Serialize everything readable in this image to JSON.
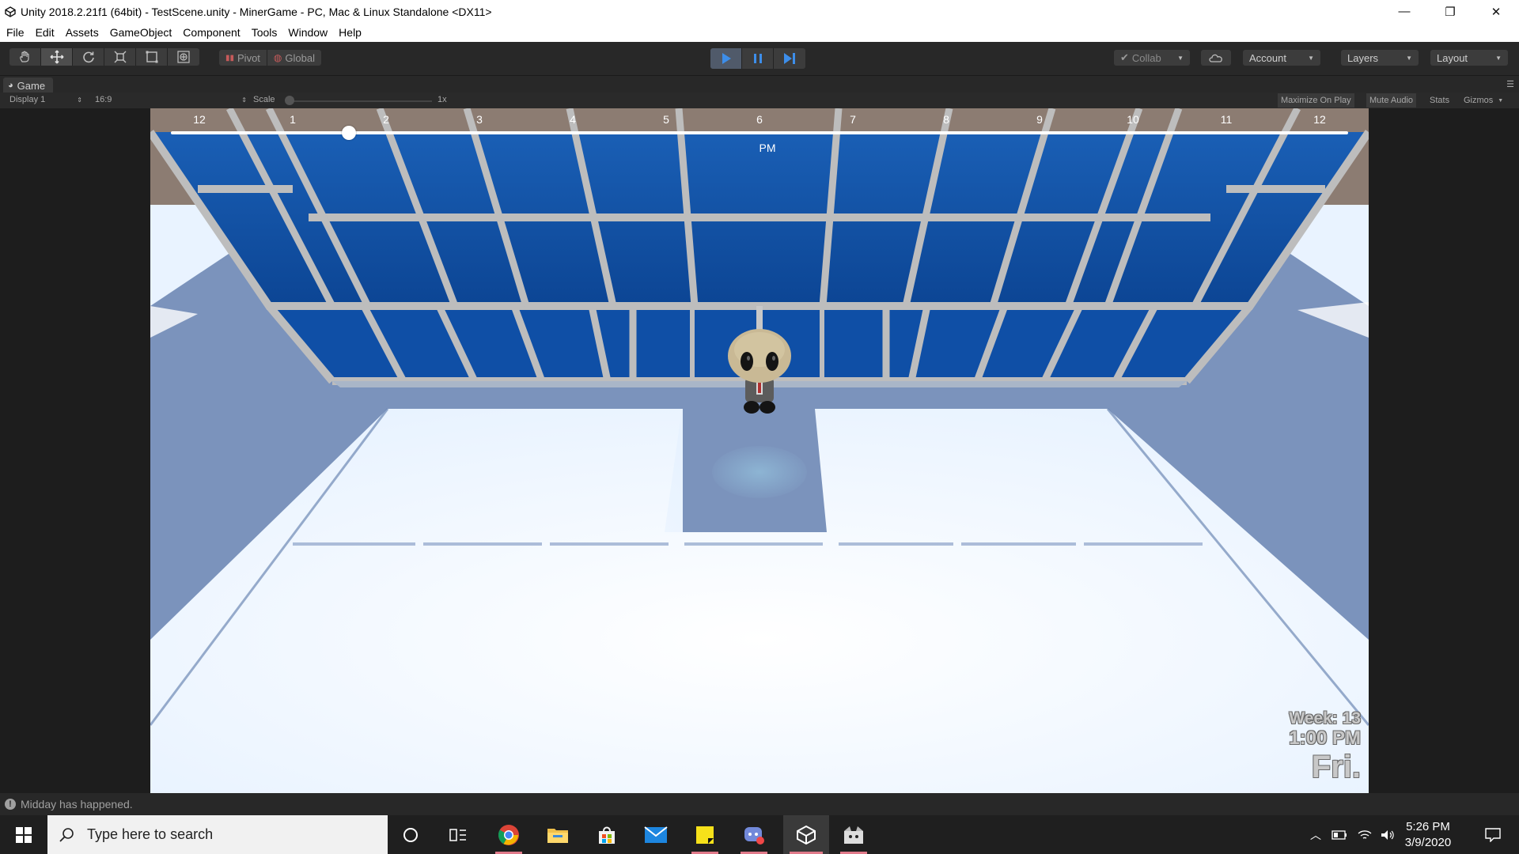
{
  "window": {
    "title": "Unity 2018.2.21f1 (64bit) - TestScene.unity - MinerGame - PC, Mac & Linux Standalone <DX11>",
    "controls": [
      "—",
      "❐",
      "✕"
    ]
  },
  "menu": [
    "File",
    "Edit",
    "Assets",
    "GameObject",
    "Component",
    "Tools",
    "Window",
    "Help"
  ],
  "toolbar": {
    "tools": [
      "hand-tool-icon",
      "move-tool-icon",
      "rotate-tool-icon",
      "scale-tool-icon",
      "rect-tool-icon",
      "transform-tool-icon"
    ],
    "pivot": "Pivot",
    "global": "Global",
    "collab": "Collab",
    "account": "Account",
    "layers": "Layers",
    "layout": "Layout",
    "play_state": "playing"
  },
  "game_tab": {
    "label": "Game"
  },
  "game_toolbar": {
    "display": "Display 1",
    "aspect": "16:9",
    "scale_label": "Scale",
    "scale_value": "1x",
    "maximize_on_play": "Maximize On Play",
    "mute_audio": "Mute Audio",
    "stats": "Stats",
    "gizmos": "Gizmos"
  },
  "game": {
    "timeline_hours": [
      "12",
      "1",
      "2",
      "3",
      "4",
      "5",
      "6",
      "7",
      "8",
      "9",
      "10",
      "11",
      "12"
    ],
    "timeline_position_hours": 1.6,
    "period": "PM",
    "hud": {
      "week": "Week: 13",
      "time": "1:00 PM",
      "day": "Fri."
    }
  },
  "status": {
    "message": "Midday has happened."
  },
  "taskbar": {
    "search_placeholder": "Type here to search",
    "time": "5:26 PM",
    "date": "3/9/2020",
    "apps": [
      "chrome-icon",
      "file-explorer-icon",
      "store-icon",
      "mail-icon",
      "sticky-notes-icon",
      "discord-icon",
      "unity-icon",
      "game-app-icon"
    ]
  },
  "colors": {
    "window_blue": "#1150a8",
    "frame_gray": "#b9b9b9",
    "floor_white": "#f4f9ff",
    "floor_shadow": "#6f8ab6",
    "unity_dark": "#282828",
    "play_blue": "#3d8eea"
  }
}
